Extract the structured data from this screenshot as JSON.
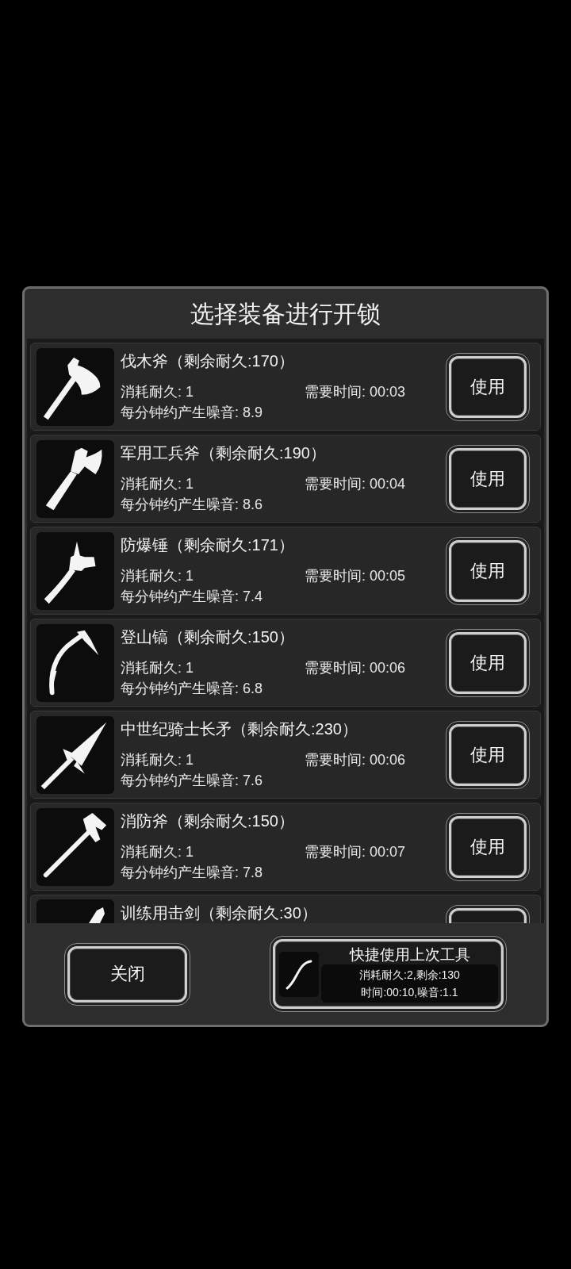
{
  "dialog": {
    "title": "选择装备进行开锁"
  },
  "tools": [
    {
      "name": "伐木斧（剩余耐久:170）",
      "cost": "消耗耐久: 1",
      "time": "需要时间: 00:03",
      "noise": "每分钟约产生噪音: 8.9",
      "button": "使用"
    },
    {
      "name": "军用工兵斧（剩余耐久:190）",
      "cost": "消耗耐久: 1",
      "time": "需要时间: 00:04",
      "noise": "每分钟约产生噪音: 8.6",
      "button": "使用"
    },
    {
      "name": "防爆锤（剩余耐久:171）",
      "cost": "消耗耐久: 1",
      "time": "需要时间: 00:05",
      "noise": "每分钟约产生噪音: 7.4",
      "button": "使用"
    },
    {
      "name": "登山镐（剩余耐久:150）",
      "cost": "消耗耐久: 1",
      "time": "需要时间: 00:06",
      "noise": "每分钟约产生噪音: 6.8",
      "button": "使用"
    },
    {
      "name": "中世纪骑士长矛（剩余耐久:230）",
      "cost": "消耗耐久: 1",
      "time": "需要时间: 00:06",
      "noise": "每分钟约产生噪音: 7.6",
      "button": "使用"
    },
    {
      "name": "消防斧（剩余耐久:150）",
      "cost": "消耗耐久: 1",
      "time": "需要时间: 00:07",
      "noise": "每分钟约产生噪音: 7.8",
      "button": "使用"
    },
    {
      "name": "训练用击剑（剩余耐久:30）"
    }
  ],
  "close_button": "关闭",
  "quick_use": {
    "title": "快捷使用上次工具",
    "cost": "消耗耐久:2,剩余:130",
    "time_noise": "时间:00:10,噪音:1.1"
  }
}
